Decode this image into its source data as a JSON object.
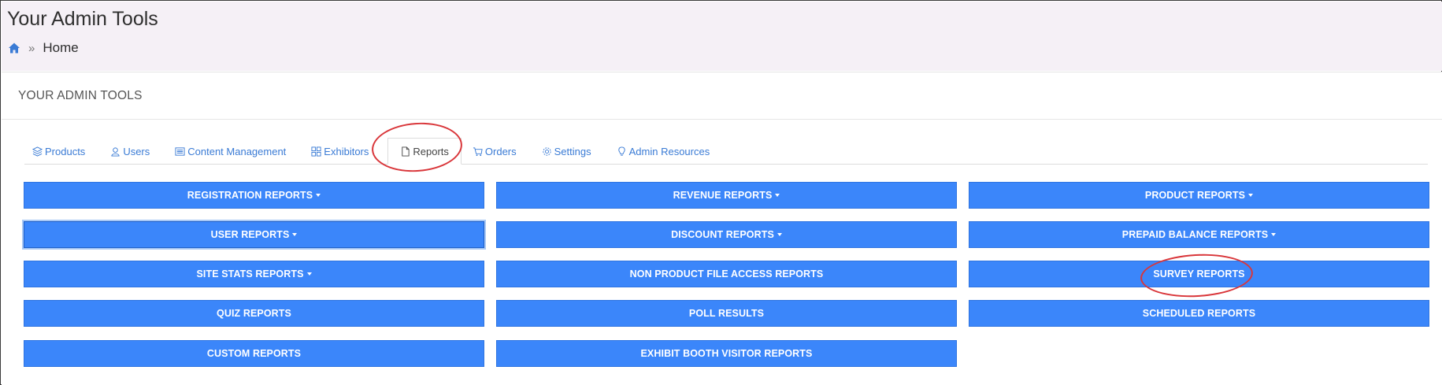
{
  "header": {
    "title": "Your Admin Tools",
    "breadcrumb_separator": "»",
    "breadcrumb_home": "Home"
  },
  "card": {
    "title": "YOUR ADMIN TOOLS"
  },
  "tabs": [
    {
      "label": "Products",
      "icon": "layers-icon",
      "active": false
    },
    {
      "label": "Users",
      "icon": "user-icon",
      "active": false
    },
    {
      "label": "Content Management",
      "icon": "list-icon",
      "active": false
    },
    {
      "label": "Exhibitors",
      "icon": "grid-icon",
      "active": false
    },
    {
      "label": "Reports",
      "icon": "file-icon",
      "active": true
    },
    {
      "label": "Orders",
      "icon": "cart-icon",
      "active": false
    },
    {
      "label": "Settings",
      "icon": "gear-icon",
      "active": false
    },
    {
      "label": "Admin Resources",
      "icon": "lightbulb-icon",
      "active": false
    }
  ],
  "report_buttons": [
    {
      "label": "REGISTRATION REPORTS",
      "dropdown": true
    },
    {
      "label": "REVENUE REPORTS",
      "dropdown": true
    },
    {
      "label": "PRODUCT REPORTS",
      "dropdown": true
    },
    {
      "label": "USER REPORTS",
      "dropdown": true,
      "focused": true
    },
    {
      "label": "DISCOUNT REPORTS",
      "dropdown": true
    },
    {
      "label": "PREPAID BALANCE REPORTS",
      "dropdown": true
    },
    {
      "label": "SITE STATS REPORTS",
      "dropdown": true
    },
    {
      "label": "NON PRODUCT FILE ACCESS REPORTS",
      "dropdown": false
    },
    {
      "label": "SURVEY REPORTS",
      "dropdown": false
    },
    {
      "label": "QUIZ REPORTS",
      "dropdown": false
    },
    {
      "label": "POLL RESULTS",
      "dropdown": false
    },
    {
      "label": "SCHEDULED REPORTS",
      "dropdown": false
    },
    {
      "label": "CUSTOM REPORTS",
      "dropdown": false
    },
    {
      "label": "EXHIBIT BOOTH VISITOR REPORTS",
      "dropdown": false
    }
  ],
  "colors": {
    "button": "#3b86fa",
    "tab_link": "#3a7bd5",
    "header_bg": "#f5f0f6",
    "annotation": "#d9363a"
  }
}
